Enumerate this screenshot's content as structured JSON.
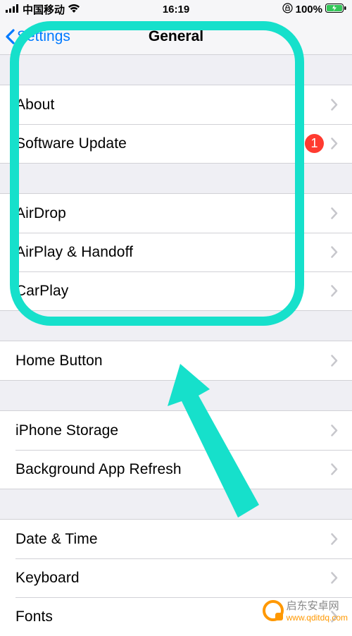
{
  "statusbar": {
    "carrier": "中国移动",
    "time": "16:19",
    "battery": "100%"
  },
  "nav": {
    "back": "Settings",
    "title": "General"
  },
  "groups": [
    {
      "rows": [
        {
          "label": "About",
          "badge": null
        },
        {
          "label": "Software Update",
          "badge": "1"
        }
      ]
    },
    {
      "rows": [
        {
          "label": "AirDrop",
          "badge": null
        },
        {
          "label": "AirPlay & Handoff",
          "badge": null
        },
        {
          "label": "CarPlay",
          "badge": null
        }
      ]
    },
    {
      "rows": [
        {
          "label": "Home Button",
          "badge": null
        }
      ]
    },
    {
      "rows": [
        {
          "label": "iPhone Storage",
          "badge": null
        },
        {
          "label": "Background App Refresh",
          "badge": null
        }
      ]
    },
    {
      "rows": [
        {
          "label": "Date & Time",
          "badge": null
        },
        {
          "label": "Keyboard",
          "badge": null
        },
        {
          "label": "Fonts",
          "badge": null
        }
      ]
    }
  ],
  "watermark": {
    "line1": "启东安卓网",
    "line2": "www.qditdq.com"
  }
}
